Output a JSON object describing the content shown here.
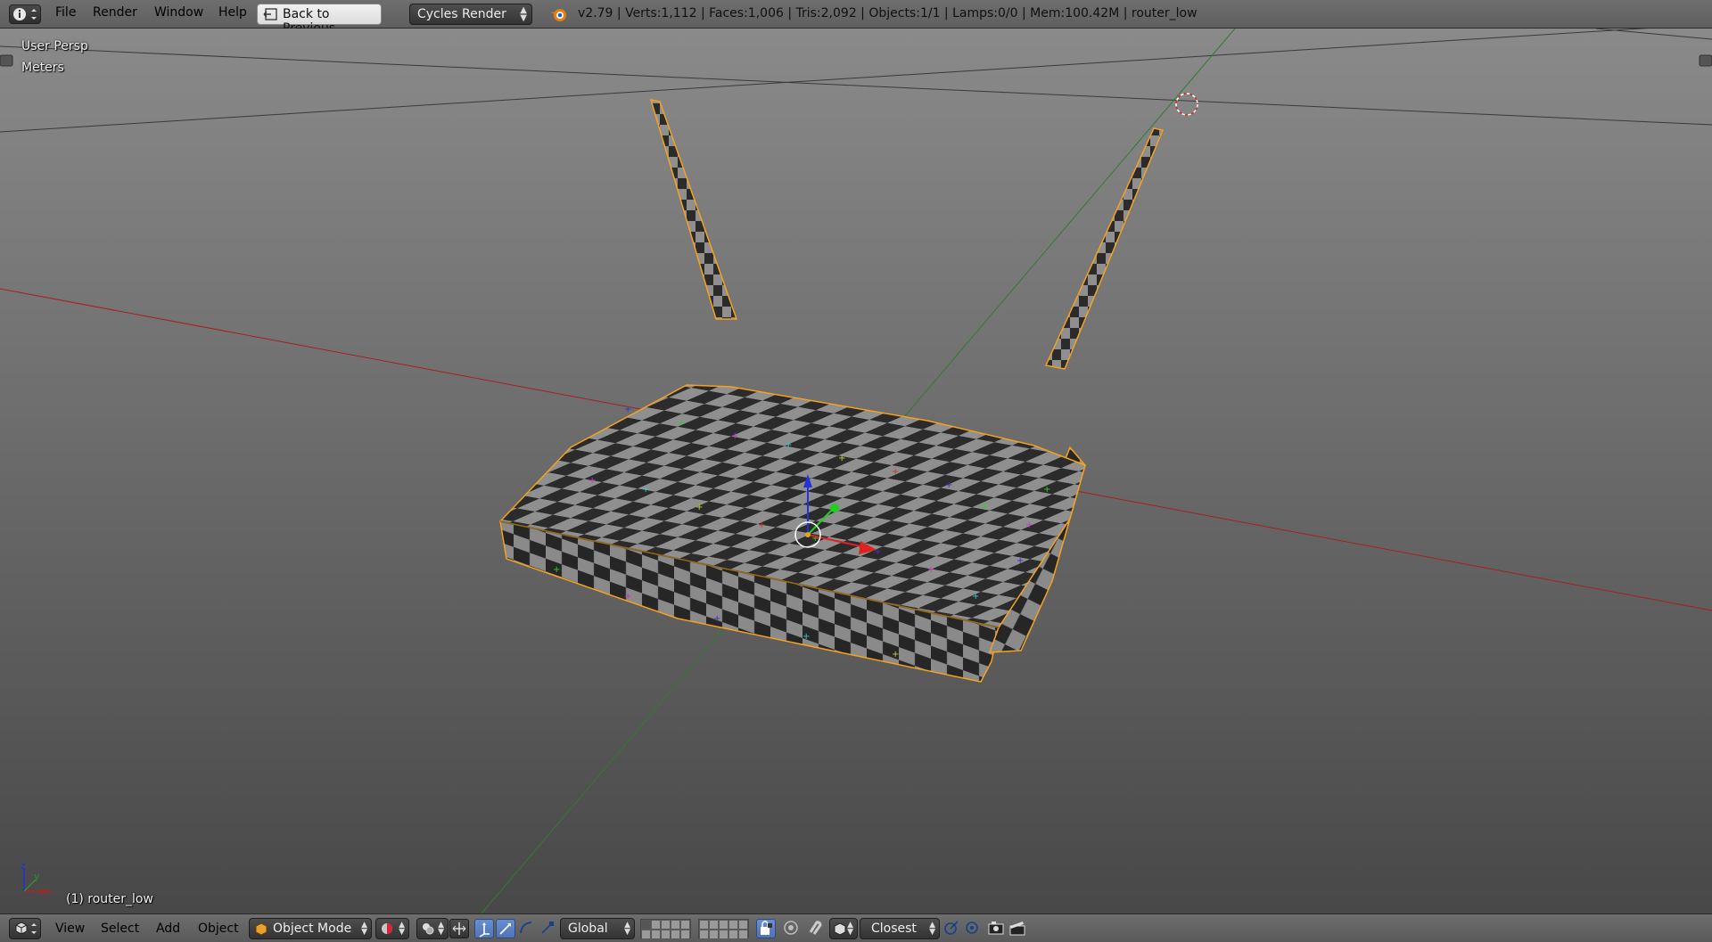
{
  "top_header": {
    "menus": [
      "File",
      "Render",
      "Window",
      "Help"
    ],
    "back_button_label": "Back to Previous",
    "render_engine": "Cycles Render",
    "stats": "v2.79 | Verts:1,112 | Faces:1,006 | Tris:2,092 | Objects:1/1 | Lamps:0/0 | Mem:100.42M | router_low"
  },
  "viewport": {
    "view_name": "User Persp",
    "units": "Meters",
    "active_object_label": "(1) router_low",
    "axis_labels": {
      "x": "x",
      "y": "y",
      "z": "z"
    },
    "colors": {
      "x_axis": "#c21a1a",
      "y_axis": "#2f8f2f",
      "selection_outline": "#f4a21f",
      "check_dark": "#2b2b2b",
      "check_light": "#8f8f8f"
    }
  },
  "bottom_header": {
    "menus": [
      "View",
      "Select",
      "Add",
      "Object"
    ],
    "mode": "Object Mode",
    "orientation": "Global",
    "snap_target": "Closest"
  },
  "icons": [
    "info-icon",
    "back-icon",
    "blender-logo-icon",
    "cube-icon",
    "shading-sphere-icon",
    "pivot-icon",
    "manipulator-icon",
    "translate-icon",
    "rotate-icon",
    "scale-icon",
    "layer-grid",
    "lock-icon",
    "proportional-edit-icon",
    "snap-magnet-icon",
    "snap-element-icon",
    "snap-align-icon",
    "render-icon",
    "clapper-icon"
  ]
}
